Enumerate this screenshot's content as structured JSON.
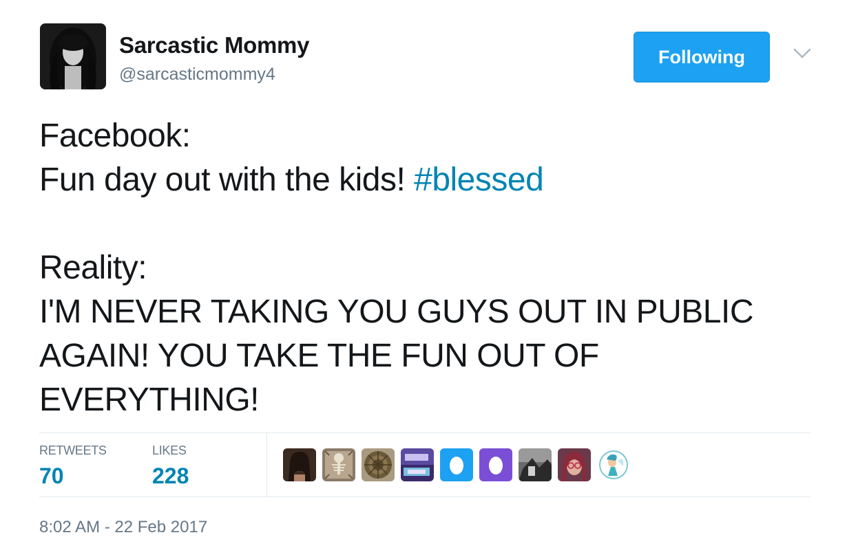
{
  "user": {
    "name": "Sarcastic Mommy",
    "handle": "@sarcasticmommy4"
  },
  "follow_button": {
    "label": "Following",
    "color": "#1da1f2"
  },
  "tweet": {
    "line1": "Facebook:",
    "line2_text": "Fun day out with the kids! ",
    "line2_hashtag": "#blessed",
    "line3": "Reality:",
    "line4": "I'M NEVER TAKING YOU GUYS OUT IN PUBLIC",
    "line5": "AGAIN! YOU TAKE THE FUN OUT OF",
    "line6": "EVERYTHING!"
  },
  "stats": {
    "retweets_label": "RETWEETS",
    "retweets_value": "70",
    "likes_label": "LIKES",
    "likes_value": "228"
  },
  "likers": [
    {
      "icon": "woman-avatar"
    },
    {
      "icon": "skeleton-avatar"
    },
    {
      "icon": "pattern-avatar"
    },
    {
      "icon": "sign-avatar"
    },
    {
      "icon": "egg-avatar-blue"
    },
    {
      "icon": "egg-avatar-purple"
    },
    {
      "icon": "blurry-photo-avatar"
    },
    {
      "icon": "girl-glasses-avatar"
    },
    {
      "icon": "fairy-avatar"
    }
  ],
  "timestamp": "8:02 AM - 22 Feb 2017",
  "colors": {
    "link": "#0084b4",
    "muted": "#657786",
    "text": "#14171a"
  }
}
